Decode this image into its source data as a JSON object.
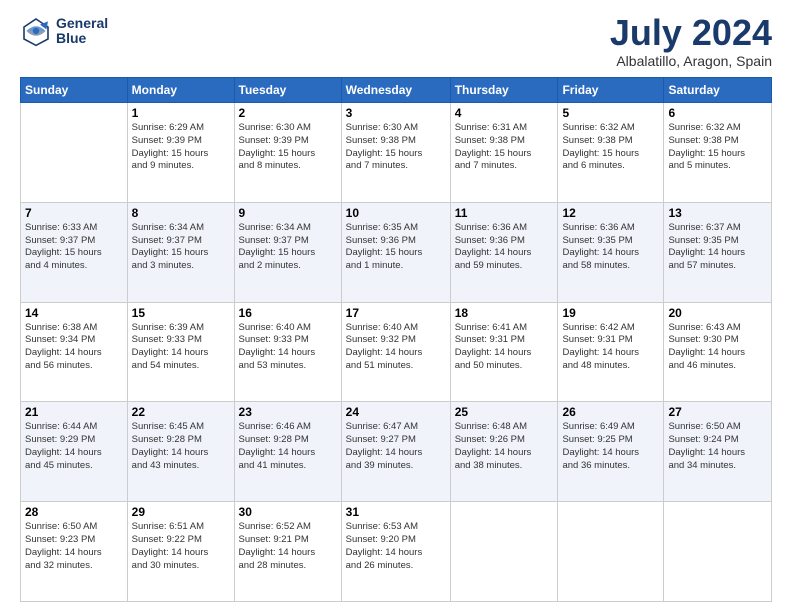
{
  "logo": {
    "line1": "General",
    "line2": "Blue"
  },
  "title": "July 2024",
  "location": "Albalatillo, Aragon, Spain",
  "days_of_week": [
    "Sunday",
    "Monday",
    "Tuesday",
    "Wednesday",
    "Thursday",
    "Friday",
    "Saturday"
  ],
  "weeks": [
    [
      {
        "day": "",
        "info": ""
      },
      {
        "day": "1",
        "info": "Sunrise: 6:29 AM\nSunset: 9:39 PM\nDaylight: 15 hours\nand 9 minutes."
      },
      {
        "day": "2",
        "info": "Sunrise: 6:30 AM\nSunset: 9:39 PM\nDaylight: 15 hours\nand 8 minutes."
      },
      {
        "day": "3",
        "info": "Sunrise: 6:30 AM\nSunset: 9:38 PM\nDaylight: 15 hours\nand 7 minutes."
      },
      {
        "day": "4",
        "info": "Sunrise: 6:31 AM\nSunset: 9:38 PM\nDaylight: 15 hours\nand 7 minutes."
      },
      {
        "day": "5",
        "info": "Sunrise: 6:32 AM\nSunset: 9:38 PM\nDaylight: 15 hours\nand 6 minutes."
      },
      {
        "day": "6",
        "info": "Sunrise: 6:32 AM\nSunset: 9:38 PM\nDaylight: 15 hours\nand 5 minutes."
      }
    ],
    [
      {
        "day": "7",
        "info": "Sunrise: 6:33 AM\nSunset: 9:37 PM\nDaylight: 15 hours\nand 4 minutes."
      },
      {
        "day": "8",
        "info": "Sunrise: 6:34 AM\nSunset: 9:37 PM\nDaylight: 15 hours\nand 3 minutes."
      },
      {
        "day": "9",
        "info": "Sunrise: 6:34 AM\nSunset: 9:37 PM\nDaylight: 15 hours\nand 2 minutes."
      },
      {
        "day": "10",
        "info": "Sunrise: 6:35 AM\nSunset: 9:36 PM\nDaylight: 15 hours\nand 1 minute."
      },
      {
        "day": "11",
        "info": "Sunrise: 6:36 AM\nSunset: 9:36 PM\nDaylight: 14 hours\nand 59 minutes."
      },
      {
        "day": "12",
        "info": "Sunrise: 6:36 AM\nSunset: 9:35 PM\nDaylight: 14 hours\nand 58 minutes."
      },
      {
        "day": "13",
        "info": "Sunrise: 6:37 AM\nSunset: 9:35 PM\nDaylight: 14 hours\nand 57 minutes."
      }
    ],
    [
      {
        "day": "14",
        "info": "Sunrise: 6:38 AM\nSunset: 9:34 PM\nDaylight: 14 hours\nand 56 minutes."
      },
      {
        "day": "15",
        "info": "Sunrise: 6:39 AM\nSunset: 9:33 PM\nDaylight: 14 hours\nand 54 minutes."
      },
      {
        "day": "16",
        "info": "Sunrise: 6:40 AM\nSunset: 9:33 PM\nDaylight: 14 hours\nand 53 minutes."
      },
      {
        "day": "17",
        "info": "Sunrise: 6:40 AM\nSunset: 9:32 PM\nDaylight: 14 hours\nand 51 minutes."
      },
      {
        "day": "18",
        "info": "Sunrise: 6:41 AM\nSunset: 9:31 PM\nDaylight: 14 hours\nand 50 minutes."
      },
      {
        "day": "19",
        "info": "Sunrise: 6:42 AM\nSunset: 9:31 PM\nDaylight: 14 hours\nand 48 minutes."
      },
      {
        "day": "20",
        "info": "Sunrise: 6:43 AM\nSunset: 9:30 PM\nDaylight: 14 hours\nand 46 minutes."
      }
    ],
    [
      {
        "day": "21",
        "info": "Sunrise: 6:44 AM\nSunset: 9:29 PM\nDaylight: 14 hours\nand 45 minutes."
      },
      {
        "day": "22",
        "info": "Sunrise: 6:45 AM\nSunset: 9:28 PM\nDaylight: 14 hours\nand 43 minutes."
      },
      {
        "day": "23",
        "info": "Sunrise: 6:46 AM\nSunset: 9:28 PM\nDaylight: 14 hours\nand 41 minutes."
      },
      {
        "day": "24",
        "info": "Sunrise: 6:47 AM\nSunset: 9:27 PM\nDaylight: 14 hours\nand 39 minutes."
      },
      {
        "day": "25",
        "info": "Sunrise: 6:48 AM\nSunset: 9:26 PM\nDaylight: 14 hours\nand 38 minutes."
      },
      {
        "day": "26",
        "info": "Sunrise: 6:49 AM\nSunset: 9:25 PM\nDaylight: 14 hours\nand 36 minutes."
      },
      {
        "day": "27",
        "info": "Sunrise: 6:50 AM\nSunset: 9:24 PM\nDaylight: 14 hours\nand 34 minutes."
      }
    ],
    [
      {
        "day": "28",
        "info": "Sunrise: 6:50 AM\nSunset: 9:23 PM\nDaylight: 14 hours\nand 32 minutes."
      },
      {
        "day": "29",
        "info": "Sunrise: 6:51 AM\nSunset: 9:22 PM\nDaylight: 14 hours\nand 30 minutes."
      },
      {
        "day": "30",
        "info": "Sunrise: 6:52 AM\nSunset: 9:21 PM\nDaylight: 14 hours\nand 28 minutes."
      },
      {
        "day": "31",
        "info": "Sunrise: 6:53 AM\nSunset: 9:20 PM\nDaylight: 14 hours\nand 26 minutes."
      },
      {
        "day": "",
        "info": ""
      },
      {
        "day": "",
        "info": ""
      },
      {
        "day": "",
        "info": ""
      }
    ]
  ]
}
